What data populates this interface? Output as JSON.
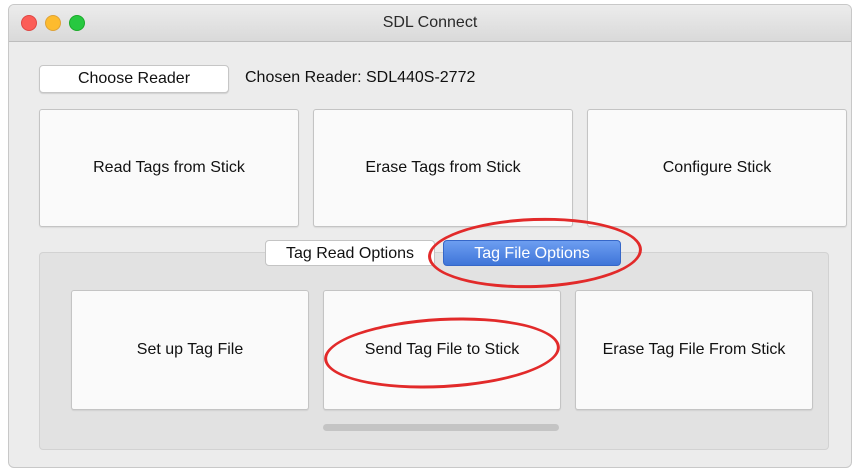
{
  "window": {
    "title": "SDL Connect"
  },
  "reader": {
    "choose_label": "Choose Reader",
    "chosen_text": "Chosen Reader: SDL440S-2772"
  },
  "stick_actions": [
    {
      "label": "Read Tags from Stick"
    },
    {
      "label": "Erase Tags from Stick"
    },
    {
      "label": "Configure Stick"
    }
  ],
  "tabs": [
    {
      "label": "Tag Read Options",
      "selected": false
    },
    {
      "label": "Tag File Options",
      "selected": true
    }
  ],
  "file_actions": [
    {
      "label": "Set up Tag File"
    },
    {
      "label": "Send Tag File to Stick"
    },
    {
      "label": "Erase Tag File From Stick"
    }
  ],
  "colors": {
    "selected_tab": "#4a7fe0",
    "annotation": "#e22a2a"
  }
}
